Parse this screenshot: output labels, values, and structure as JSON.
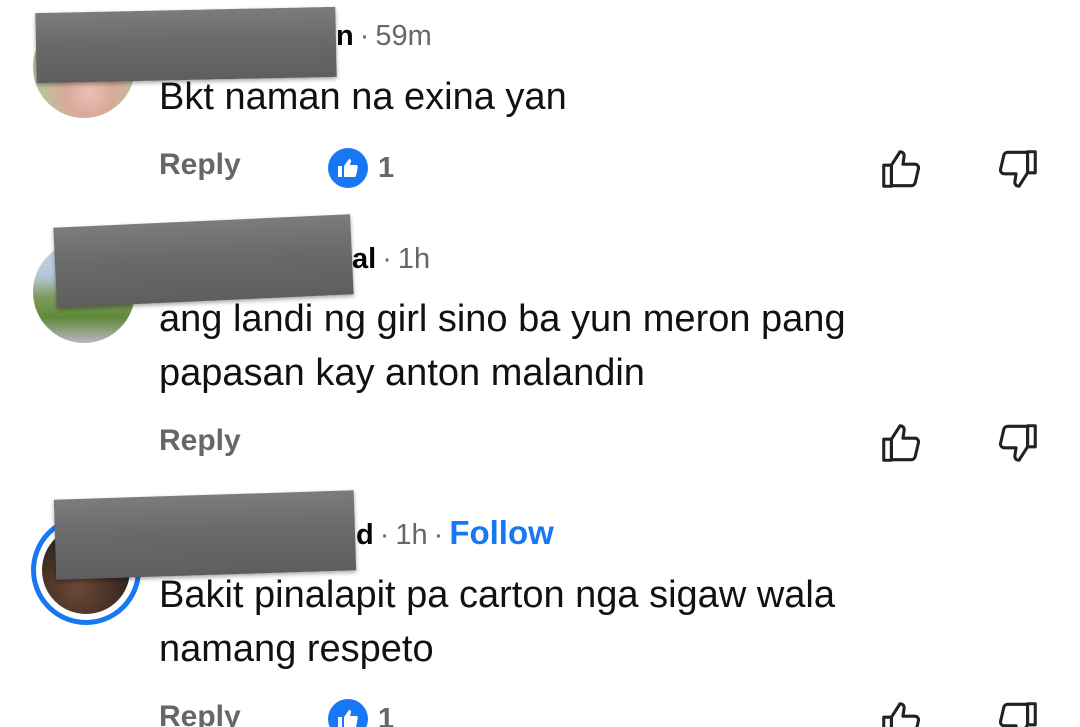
{
  "comments": [
    {
      "name_tail": "n",
      "time": "59m",
      "text_lines": [
        "Bkt naman na exina yan"
      ],
      "reply_label": "Reply",
      "like_count": "1",
      "has_reaction": true,
      "follow_label": ""
    },
    {
      "name_tail": "al",
      "time": "1h",
      "text_lines": [
        "ang landi ng girl sino ba yun meron pang",
        "papasan kay anton malandin"
      ],
      "reply_label": "Reply",
      "like_count": "",
      "has_reaction": false,
      "follow_label": ""
    },
    {
      "name_tail": "d",
      "time": "1h",
      "text_lines": [
        "Bakit pinalapit pa carton nga sigaw wala",
        "namang respeto"
      ],
      "reply_label": "Reply",
      "like_count": "1",
      "has_reaction": true,
      "follow_label": "Follow"
    }
  ],
  "separator": "·",
  "icons": {
    "upvote": "thumbs-up-outline-icon",
    "downvote": "thumbs-down-outline-icon",
    "reaction": "like-reaction-icon"
  },
  "colors": {
    "accent": "#1877f2",
    "muted": "#65676b",
    "text": "#111111",
    "redaction": "#6a6a6a"
  }
}
